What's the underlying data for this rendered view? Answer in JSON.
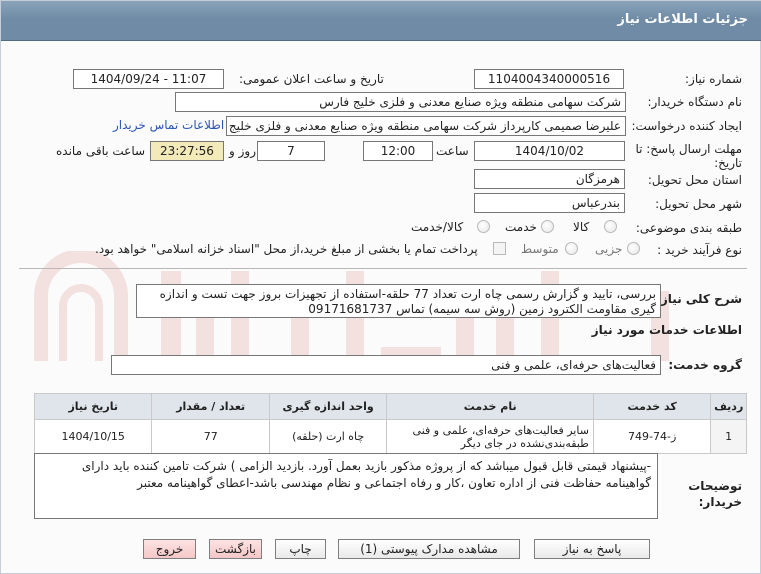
{
  "header": {
    "title": "جزئیات اطلاعات نیاز"
  },
  "need_number": {
    "label": "شماره نیاز:",
    "value": "1104004340000516"
  },
  "announce": {
    "label": "تاریخ و ساعت اعلان عمومی:",
    "value": "1404/09/24 - 11:07"
  },
  "buyer_org": {
    "label": "نام دستگاه خریدار:",
    "value": "شرکت سهامی منطقه ویژه صنایع معدنی و فلزی خلیج فارس"
  },
  "creator": {
    "label": "ایجاد کننده درخواست:",
    "value": "علیرضا صمیمی کارپرداز شرکت سهامی منطقه ویژه صنایع معدنی و فلزی خلیج فارس",
    "contact_link": "اطلاعات تماس خریدار"
  },
  "deadline": {
    "label": "مهلت ارسال پاسخ: تا",
    "label2": "تاریخ:",
    "date": "1404/10/02",
    "time_label": "ساعت",
    "time": "12:00",
    "days": "7",
    "days_label": "روز و",
    "remaining": "23:27:56",
    "remaining_label": "ساعت باقی مانده"
  },
  "province": {
    "label": "استان محل تحویل:",
    "value": "هرمزگان"
  },
  "city": {
    "label": "شهر محل تحویل:",
    "value": "بندرعباس"
  },
  "category": {
    "label": "طبقه بندی موضوعی:",
    "options": [
      "کالا",
      "خدمت",
      "کالا/خدمت"
    ]
  },
  "process": {
    "label": "نوع فرآیند خرید :",
    "options": [
      "جزیی",
      "متوسط"
    ],
    "treasury_text": "پرداخت تمام یا بخشی از مبلغ خرید،از محل \"اسناد خزانه اسلامی\" خواهد بود."
  },
  "summary": {
    "label": "شرح کلی نیاز:",
    "value": "بررسی، تایید و گزارش رسمی چاه ارت تعداد 77 حلقه-استفاده از تجهیزات بروز جهت تست و اندازه گیری مقاومت الکترود زمین (روش سه سیمه) تماس 09171681737"
  },
  "services_title": "اطلاعات خدمات مورد نیاز",
  "service_group": {
    "label": "گروه خدمت:",
    "value": "فعالیت‌های حرفه‌ای، علمی و فنی"
  },
  "table": {
    "headers": [
      "ردیف",
      "کد خدمت",
      "نام خدمت",
      "واحد اندازه گیری",
      "تعداد / مقدار",
      "تاریخ نیاز"
    ],
    "rows": [
      [
        "1",
        "ز-74-749",
        "سایر فعالیت‌های حرفه‌ای، علمی و فنی طبقه‌بندی‌نشده در جای دیگر",
        "چاه ارت (حلقه)",
        "77",
        "1404/10/15"
      ]
    ]
  },
  "buyer_notes": {
    "label": "توضیحات خریدار:",
    "value": "-پیشنهاد قیمتی قابل قبول میباشد که از پروژه مذکور بازید بعمل آورد.  بازدید الزامی ) شرکت تامین کننده باید دارای گواهینامه حفاظت فنی از اداره تعاون ،کار و رفاه اجتماعی و نظام مهندسی باشد-اعطای گواهینامه معتبر"
  },
  "buttons": {
    "reply": "پاسخ به نیاز",
    "docs": "مشاهده مدارک پیوستی (1)",
    "print": "چاپ",
    "back": "بازگشت",
    "exit": "خروج"
  },
  "colors": {
    "header_bg": "#6f8ba6",
    "timer_bg": "#f3eab9",
    "link": "#2a55b8"
  }
}
